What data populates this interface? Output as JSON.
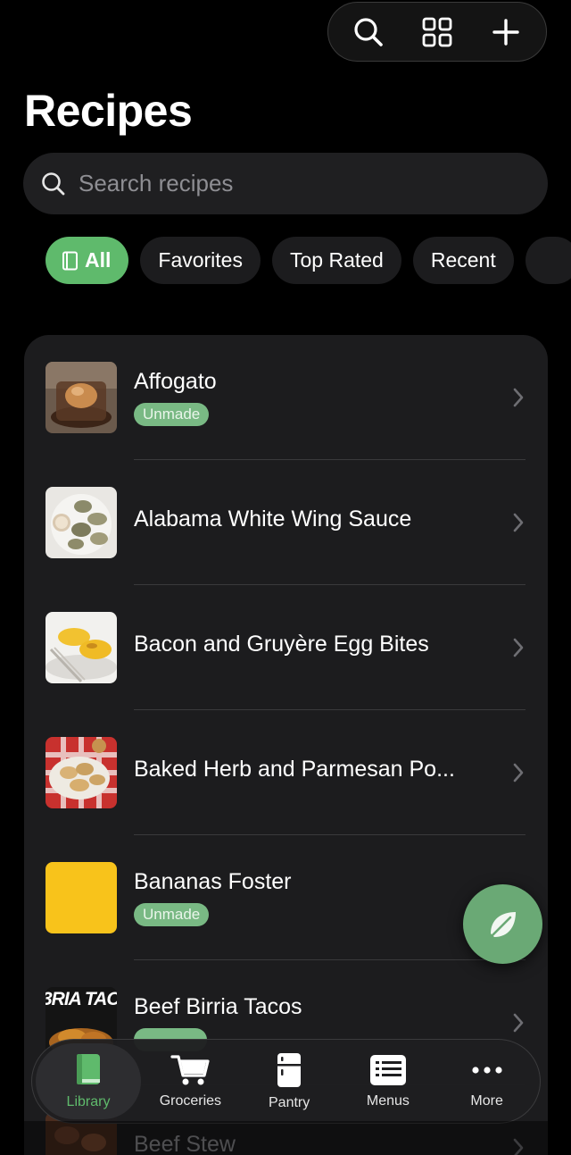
{
  "toolbar": {
    "icons": [
      "search-icon",
      "grid-icon",
      "plus-icon"
    ]
  },
  "page": {
    "title": "Recipes"
  },
  "search": {
    "placeholder": "Search recipes"
  },
  "filters": [
    {
      "label": "All",
      "active": true
    },
    {
      "label": "Favorites"
    },
    {
      "label": "Top Rated"
    },
    {
      "label": "Recent"
    }
  ],
  "recipes": [
    {
      "title": "Affogato",
      "badge": "Unmade"
    },
    {
      "title": "Alabama White Wing Sauce"
    },
    {
      "title": "Bacon and Gruyère Egg Bites"
    },
    {
      "title": "Baked Herb and Parmesan Po..."
    },
    {
      "title": "Bananas Foster",
      "badge": "Unmade"
    },
    {
      "title": "Beef Birria Tacos",
      "thumb_text": "3RIA TAC"
    },
    {
      "title": "Beef Stew"
    }
  ],
  "tabbar": {
    "items": [
      {
        "label": "Library",
        "active": true
      },
      {
        "label": "Groceries"
      },
      {
        "label": "Pantry"
      },
      {
        "label": "Menus"
      },
      {
        "label": "More"
      }
    ]
  },
  "colors": {
    "accent": "#5fba6c",
    "badge": "#79b984",
    "fab": "#6aa975",
    "card": "#1c1c1e"
  }
}
